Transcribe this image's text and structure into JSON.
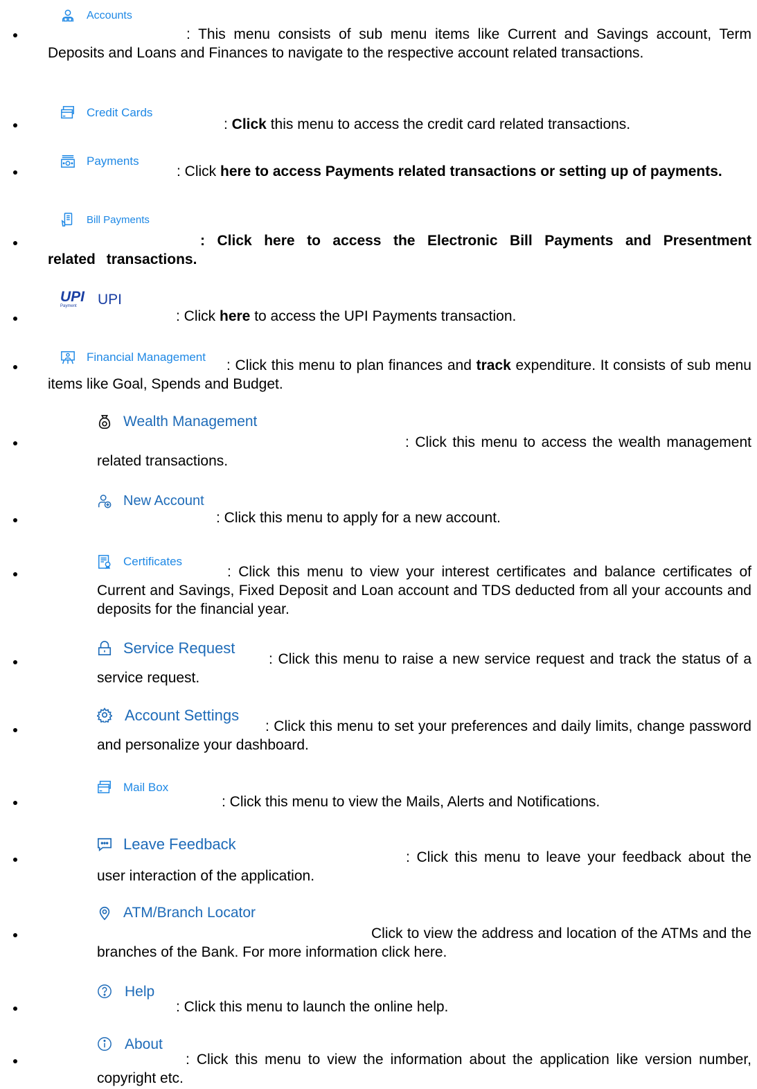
{
  "items": [
    {
      "label": "Accounts",
      "icon": "users-icon",
      "desc": ": This menu consists of sub menu items like Current and Savings account, Term Deposits and Loans and Finances to navigate to the respective account related transactions."
    },
    {
      "label": "Credit Cards",
      "icon": "credit-card-icon",
      "sep": ": ",
      "bold": "Click",
      "rest": " this menu to access the credit card related transactions."
    },
    {
      "label": "Payments",
      "icon": "money-icon",
      "sep": ": Click ",
      "bold": "here to access Payments related transactions or setting up of payments."
    },
    {
      "label": "Bill Payments",
      "icon": "bill-phone-icon",
      "bold": ": Click here to access the Electronic Bill Payments and Presentment related transactions."
    },
    {
      "label": "UPI",
      "icon": "upi-logo-icon",
      "logo": "UPI",
      "logo_sub": "Payment",
      "sep": ": Click ",
      "bold": "here",
      "rest": " to access the UPI Payments transaction."
    },
    {
      "label": "Financial Management",
      "icon": "presentation-icon",
      "sep": ": Click this menu to plan finances and ",
      "bold": "track",
      "rest": " expenditure. It consists of sub menu items like Goal, Spends and Budget."
    },
    {
      "label": "Wealth Management",
      "icon": "money-bag-icon",
      "desc": ": Click this menu to access the wealth management related transactions."
    },
    {
      "label": "New Account",
      "icon": "add-user-icon",
      "desc": ": Click this menu to apply for a new account."
    },
    {
      "label": "Certificates",
      "icon": "certificate-icon",
      "desc": ": Click this menu to view your interest certificates and balance certificates of Current and Savings, Fixed Deposit and Loan account and TDS deducted from all your accounts and deposits for the financial year."
    },
    {
      "label": "Service Request",
      "icon": "lock-icon",
      "desc": ": Click this menu to raise a new service request and track the status of a service request."
    },
    {
      "label": "Account Settings",
      "icon": "gear-icon",
      "desc": ": Click this menu to set your preferences and daily limits, change password and personalize your dashboard."
    },
    {
      "label": "Mail Box",
      "icon": "mailbox-icon",
      "desc": ": Click this menu to view the Mails, Alerts and Notifications."
    },
    {
      "label": "Leave Feedback",
      "icon": "chat-icon",
      "desc": ": Click this menu to leave your feedback about the user interaction of the application."
    },
    {
      "label": "ATM/Branch Locator",
      "icon": "location-pin-icon",
      "desc": "Click to view the address and location of the ATMs and the branches of the Bank. For more information click here."
    },
    {
      "label": "Help",
      "icon": "help-icon",
      "desc": ": Click this menu to launch the online help."
    },
    {
      "label": "About",
      "icon": "info-icon",
      "desc": ": Click this menu to view the information about the application like version number, copyright etc."
    }
  ],
  "colors": {
    "accent": "#1e88e5",
    "text": "#000000"
  }
}
